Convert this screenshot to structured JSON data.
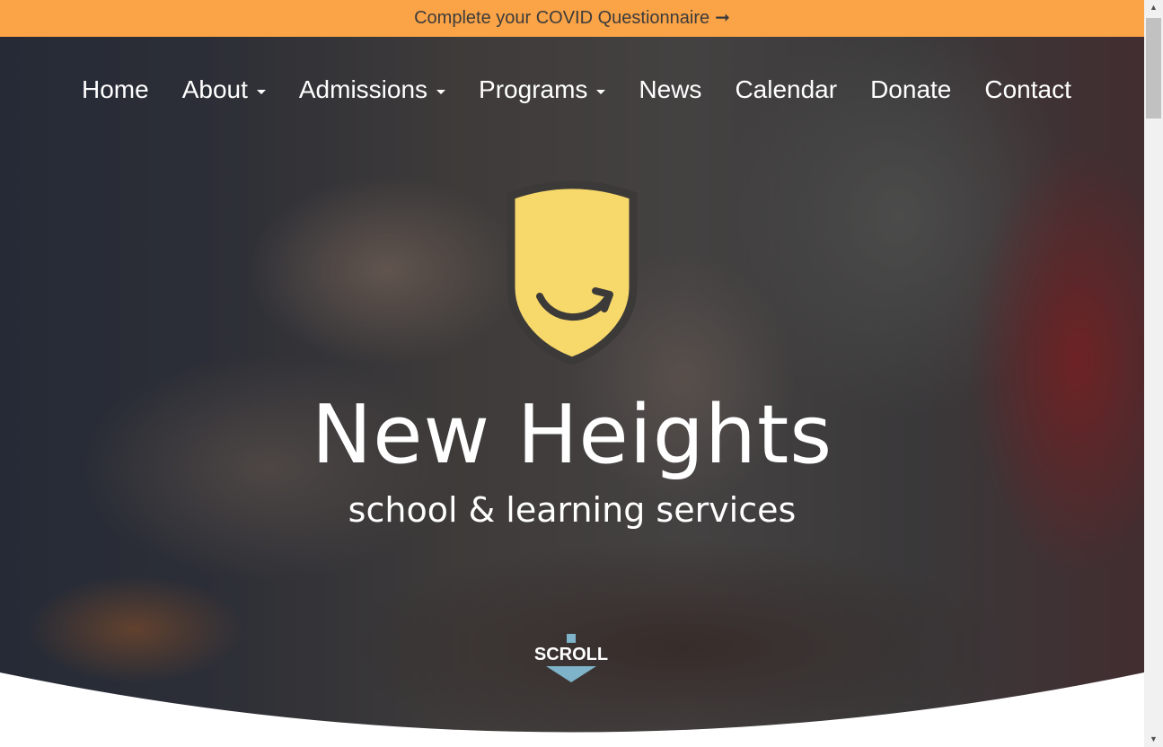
{
  "banner": {
    "text": "Complete your COVID Questionnaire",
    "arrow": "➞",
    "color": "#fba447"
  },
  "nav": {
    "items": [
      {
        "label": "Home",
        "has_dropdown": false
      },
      {
        "label": "About",
        "has_dropdown": true
      },
      {
        "label": "Admissions",
        "has_dropdown": true
      },
      {
        "label": "Programs",
        "has_dropdown": true
      },
      {
        "label": "News",
        "has_dropdown": false
      },
      {
        "label": "Calendar",
        "has_dropdown": false
      },
      {
        "label": "Donate",
        "has_dropdown": false
      },
      {
        "label": "Contact",
        "has_dropdown": false
      }
    ]
  },
  "hero": {
    "logo_icon": "shield-smile-icon",
    "logo_color": "#f7d86a",
    "title": "New Heights",
    "subtitle": "school & learning services"
  },
  "scroll": {
    "label": "SCROLL",
    "icon": "down-arrow-icon",
    "color": "#7fb3c9"
  }
}
